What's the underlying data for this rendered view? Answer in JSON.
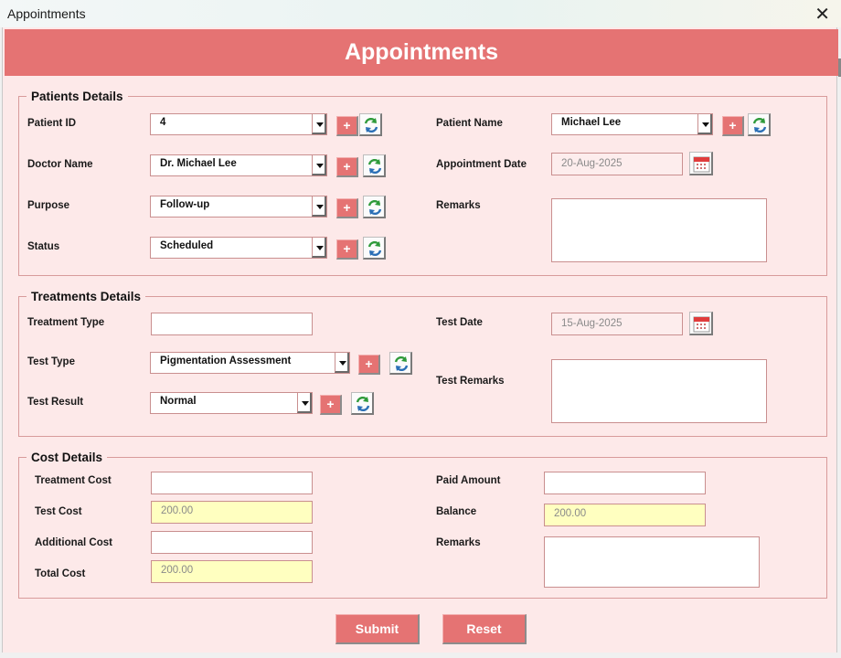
{
  "window": {
    "title": "Appointments",
    "close_glyph": "✕"
  },
  "header": {
    "title": "Appointments"
  },
  "patients_details": {
    "legend": "Patients Details",
    "patient_id": {
      "label": "Patient ID",
      "value": "4"
    },
    "doctor_name": {
      "label": "Doctor Name",
      "value": "Dr. Michael Lee"
    },
    "purpose": {
      "label": "Purpose",
      "value": "Follow-up"
    },
    "status": {
      "label": "Status",
      "value": "Scheduled"
    },
    "patient_name": {
      "label": "Patient Name",
      "value": "Michael Lee"
    },
    "appointment_date": {
      "label": "Appointment Date",
      "value": "20-Aug-2025"
    },
    "remarks": {
      "label": "Remarks",
      "value": ""
    }
  },
  "treatments_details": {
    "legend": "Treatments Details",
    "treatment_type": {
      "label": "Treatment Type",
      "value": ""
    },
    "test_type": {
      "label": "Test Type",
      "value": "Pigmentation Assessment"
    },
    "test_result": {
      "label": "Test Result",
      "value": "Normal"
    },
    "test_date": {
      "label": "Test Date",
      "value": "15-Aug-2025"
    },
    "test_remarks": {
      "label": "Test Remarks",
      "value": ""
    }
  },
  "cost_details": {
    "legend": "Cost Details",
    "treatment_cost": {
      "label": "Treatment Cost",
      "value": ""
    },
    "test_cost": {
      "label": "Test Cost",
      "value": "200.00"
    },
    "additional_cost": {
      "label": "Additional Cost",
      "value": ""
    },
    "total_cost": {
      "label": "Total Cost",
      "value": "200.00"
    },
    "paid_amount": {
      "label": "Paid Amount",
      "value": ""
    },
    "balance": {
      "label": "Balance",
      "value": "200.00"
    },
    "remarks": {
      "label": "Remarks",
      "value": ""
    }
  },
  "add_button_glyph": "+",
  "icons": {
    "add": "plus-icon",
    "refresh": "refresh-icon",
    "calendar": "calendar-icon",
    "dropdown": "chevron-down-icon"
  },
  "colors": {
    "accent": "#e57373",
    "form_bg": "#fde9e9",
    "readonly_yellow": "#ffffc0",
    "border": "#c98f8f"
  },
  "actions": {
    "submit_label": "Submit",
    "reset_label": "Reset"
  }
}
